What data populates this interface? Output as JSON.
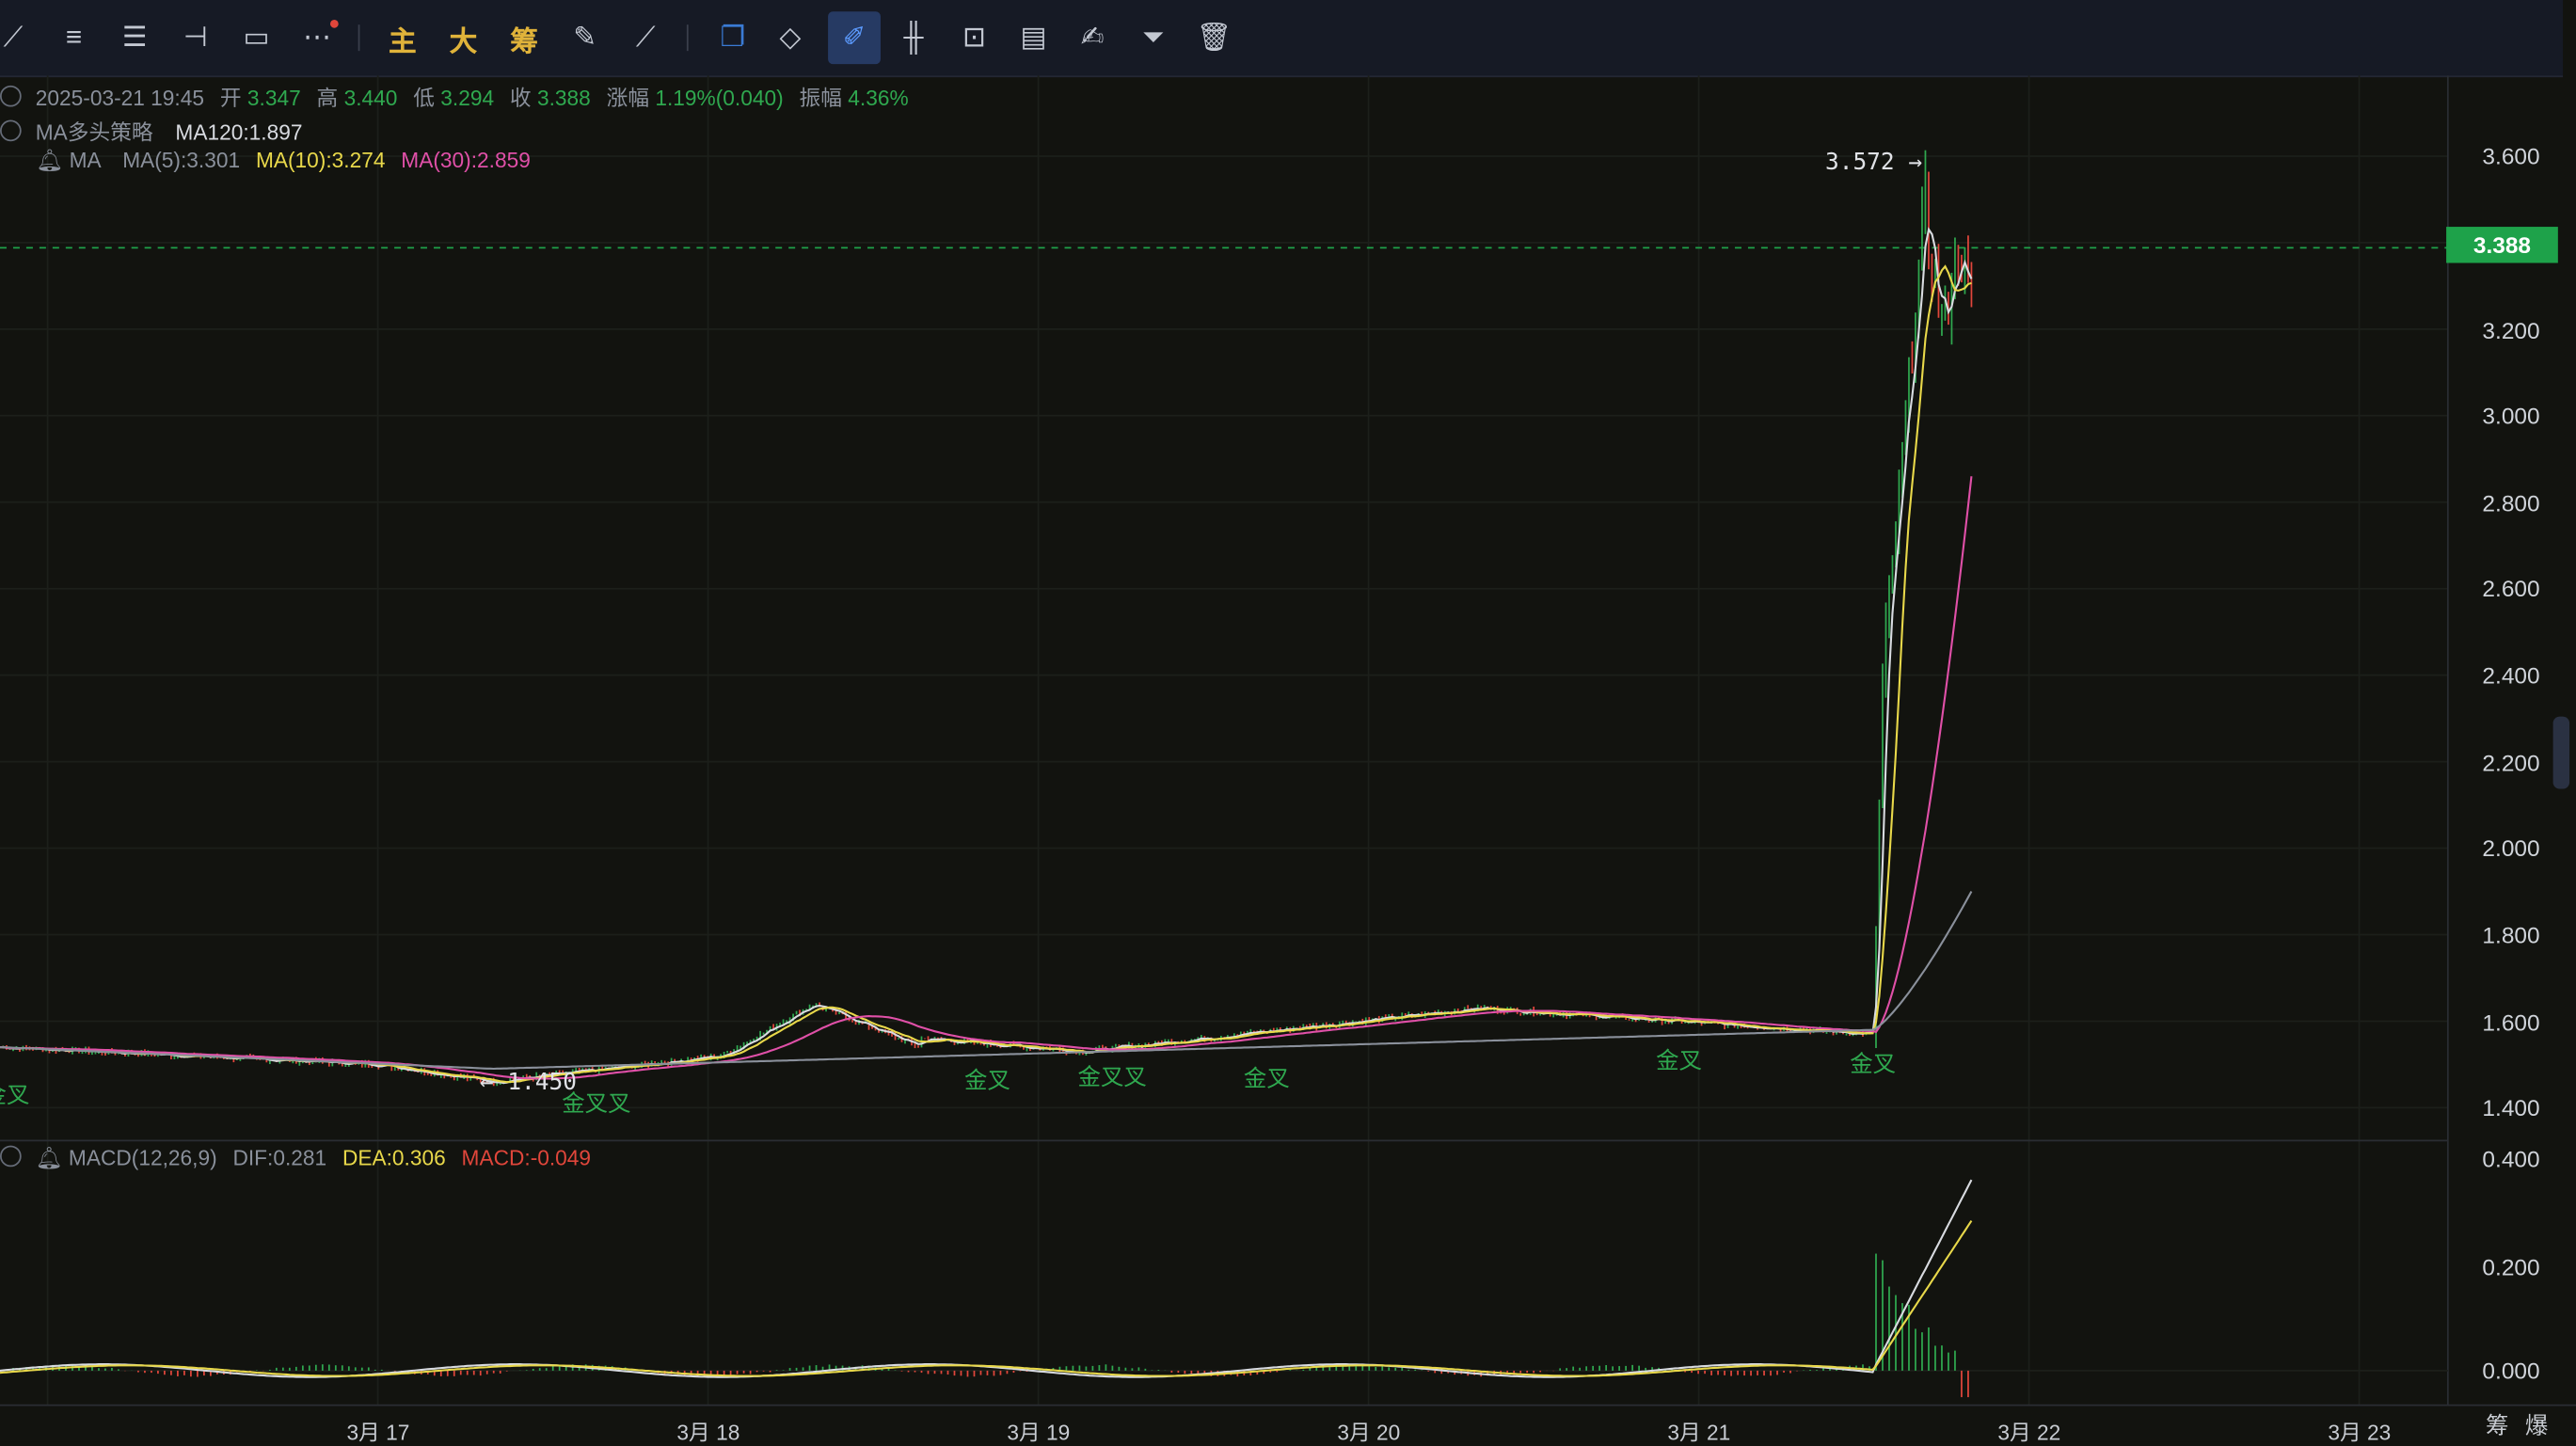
{
  "toolbar": {
    "items": [
      {
        "name": "trendline-icon",
        "glyph": "⟋"
      },
      {
        "name": "parallel-lines-icon",
        "glyph": "≡"
      },
      {
        "name": "horizontal-lines-icon",
        "glyph": "☰"
      },
      {
        "name": "horizontal-ray-icon",
        "glyph": "⊣"
      },
      {
        "name": "rectangle-icon",
        "glyph": "▭"
      },
      {
        "name": "more-icon",
        "glyph": "⋯"
      },
      {
        "name": "main-indicator",
        "label": "主"
      },
      {
        "name": "big-order",
        "label": "大"
      },
      {
        "name": "chip-distribution",
        "label": "筹"
      },
      {
        "name": "edit-drawing-icon",
        "glyph": "✎"
      },
      {
        "name": "measure-icon",
        "glyph": "⟋"
      },
      {
        "name": "layer-icon",
        "glyph": "❐"
      },
      {
        "name": "eraser-icon",
        "glyph": "◇"
      },
      {
        "name": "draw-pen-icon",
        "glyph": "✐"
      },
      {
        "name": "candles-icon",
        "glyph": "╫"
      },
      {
        "name": "lock-icon",
        "glyph": "⊡"
      },
      {
        "name": "note-icon",
        "glyph": "▤"
      },
      {
        "name": "brush-icon",
        "glyph": "✍"
      },
      {
        "name": "filter-icon",
        "glyph": "⏷"
      },
      {
        "name": "trash-icon",
        "glyph": "🗑"
      }
    ]
  },
  "ohlc": {
    "datetime": "2025-03-21 19:45",
    "open_label": "开",
    "open": "3.347",
    "high_label": "高",
    "high": "3.440",
    "low_label": "低",
    "low": "3.294",
    "close_label": "收",
    "close": "3.388",
    "change_label": "涨幅",
    "change": "1.19%(0.040)",
    "amplitude_label": "振幅",
    "amplitude": "4.36%"
  },
  "strategy": {
    "name": "MA多头策略",
    "ma120": "MA120:1.897"
  },
  "ma_legend": {
    "name": "MA",
    "ma5": "MA(5):3.301",
    "ma10": "MA(10):3.274",
    "ma30": "MA(30):2.859"
  },
  "macd_legend": {
    "name": "MACD(12,26,9)",
    "dif": "DIF:0.281",
    "dea": "DEA:0.306",
    "macd": "MACD:-0.049"
  },
  "price_axis": [
    "3.600",
    "3.400",
    "3.200",
    "3.000",
    "2.800",
    "2.600",
    "2.400",
    "2.200",
    "2.000",
    "1.800",
    "1.600",
    "1.400"
  ],
  "macd_axis": [
    "0.400",
    "0.200",
    "0.000"
  ],
  "current_price": "3.388",
  "high_marker": "3.572 →",
  "low_marker": "← 1.450",
  "dates": [
    "3月 17",
    "3月 18",
    "3月 19",
    "3月 20",
    "3月 21",
    "3月 22",
    "3月 23"
  ],
  "golden_cross_label": "金叉",
  "golden_cross_double": "金叉叉",
  "bottom_right": [
    "筹",
    "爆"
  ],
  "colors": {
    "up": "#2fa84f",
    "down": "#e0463b",
    "ma5": "#d8dbe0",
    "ma10": "#e8d84a",
    "ma30": "#e050a8",
    "ma120": "#8a909b",
    "accent": "#1ea24a"
  }
}
